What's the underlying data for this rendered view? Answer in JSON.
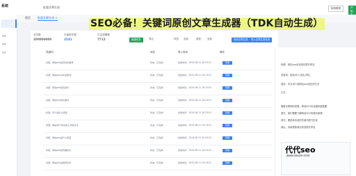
{
  "sidebar": {
    "brand": "系统"
  },
  "header": {
    "title": "批量文章生成",
    "btn_history": "使用教程",
    "btn_new": "开始生成"
  },
  "tabs": [
    {
      "label": "首页"
    },
    {
      "label": "批量文章生成 ×"
    }
  ],
  "stats": [
    {
      "label": "总字数",
      "value": "200000000"
    },
    {
      "label": "已使用字数",
      "value": "2541"
    },
    {
      "label": "已生成篇数",
      "value": "7712"
    }
  ],
  "buttons": {
    "new_task": "新建任务",
    "export": "导出",
    "batch_publish": "批量发布",
    "sync": "同步文章生成",
    "import": "导入文章生成任务"
  },
  "filters": [
    "状态：",
    "全部",
    "类型：",
    "全部",
    "排序："
  ],
  "table": {
    "headers": [
      "关键词",
      "状态",
      "导入时间",
      "操作"
    ],
    "rows": [
      {
        "k": "标题：网站seo如何优化推荐",
        "s": "状态：已完成",
        "t": "创建时间：2024.06.21 10:23:01",
        "op": "查看"
      },
      {
        "k": "标题：网站seo分析关键词",
        "s": "状态：已完成",
        "t": "创建时间：2024.06.21 10:23:01",
        "op": "查看"
      },
      {
        "k": "标题：网站seo优化技巧",
        "s": "状态：已完成",
        "t": "创建时间：2024.06.21 10:23:01",
        "op": "查看"
      },
      {
        "k": "标题：网站seo优化要点",
        "s": "状态：已完成",
        "t": "创建时间：2024.06.21 10:23:01",
        "op": "查看"
      },
      {
        "k": "标题：SEO是什么意思",
        "s": "状态：已完成",
        "t": "创建时间：2024.06.21 10:23:01",
        "op": "查看"
      },
      {
        "k": "标题：网站SEO优化的工具和方法",
        "s": "状态：已完成",
        "t": "创建时间：2024.06.21 10:23:01",
        "op": "查看"
      },
      {
        "k": "标题：网站seo是什么意思",
        "s": "状态：已完成",
        "t": "创建时间：2024.06.21 10:23:01",
        "op": "查看"
      },
      {
        "k": "标题：网站seo如何做优化",
        "s": "状态：已完成",
        "t": "创建时间：2024.06.21 10:23:01",
        "op": "查看"
      },
      {
        "k": "标题：网站seo关键词优化",
        "s": "状态：已完成",
        "t": "创建时间：2024.06.21 10:23:01",
        "op": "查看"
      }
    ]
  },
  "banner": "SEO必备！关键词原创文章生成器（TDK自动生成）",
  "right": {
    "lines": [
      "标题：网站seo优化如何提升排名",
      "关键词：网站SEO,优化,排名",
      "描述：本文将介绍网站seo优化的方法",
      "正文：",
      "随着互联网的发展，网站SEO优化越来越重要",
      "首先，我们需要了解网站SEO的基本原理",
      "其次，要选择合适的关键词进行优化",
      "最后，持续更新原创内容提升排名"
    ]
  },
  "watermark": {
    "big": "代代seo",
    "small": "www.seocer.com"
  }
}
